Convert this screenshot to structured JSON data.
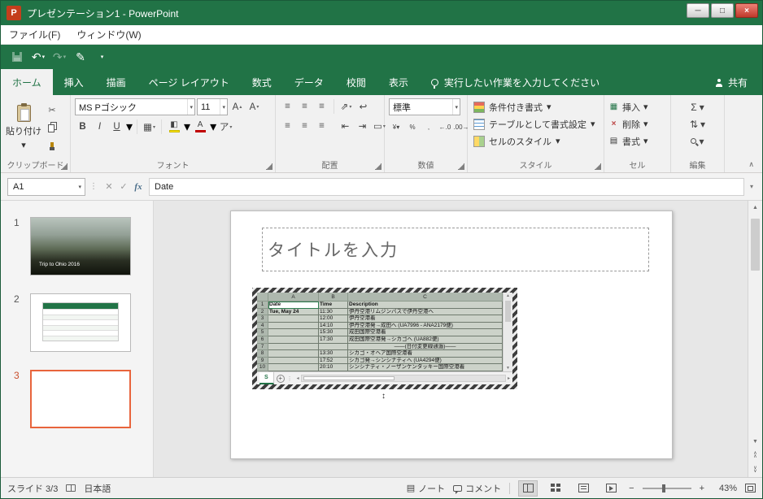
{
  "titlebar": {
    "app": "P",
    "title": "プレゼンテーション1 - PowerPoint"
  },
  "menubar": {
    "file": "ファイル(F)",
    "window": "ウィンドウ(W)"
  },
  "icons": {
    "minimize": "─",
    "maximize": "□",
    "close": "×",
    "undo": "↶",
    "redo": "↷",
    "pen": "✎",
    "caret": "▾",
    "scissors": "✂",
    "tri_up": "▴",
    "tri_down": "▾",
    "A": "A",
    "borders": "▦",
    "fill": "◧",
    "phonetic": "ア",
    "align": "≡",
    "orient": "⇗",
    "wrap": "↩",
    "indent_dec": "⇤",
    "indent_inc": "⇥",
    "merge": "▭",
    "currency": "¥",
    "percent": "%",
    "comma": ",",
    "inc_dec": "←.0",
    "dec_dec": ".00→",
    "autosum": "Σ",
    "sort": "⇅",
    "up": "▲",
    "down": "▼",
    "chev_up": "∧",
    "chev_down": "∨",
    "left": "◂",
    "right": "▸",
    "dots": "⋮",
    "updown": "↕",
    "notes": "▤",
    "collapse": "∧"
  },
  "ribbon": {
    "tabs": [
      "ホーム",
      "挿入",
      "描画",
      "ページ レイアウト",
      "数式",
      "データ",
      "校閲",
      "表示"
    ],
    "tellme": "実行したい作業を入力してください",
    "share": "共有",
    "clipboard": {
      "label": "クリップボード",
      "paste": "貼り付け"
    },
    "font": {
      "label": "フォント",
      "name": "MS Pゴシック",
      "size": "11",
      "bold": "B",
      "italic": "I",
      "underline": "U"
    },
    "align": {
      "label": "配置"
    },
    "number": {
      "label": "数値",
      "format": "標準"
    },
    "styles": {
      "label": "スタイル",
      "conditional": "条件付き書式",
      "table": "テーブルとして書式設定",
      "cell": "セルのスタイル"
    },
    "cells": {
      "label": "セル",
      "insert": "挿入",
      "delete": "削除",
      "format": "書式"
    },
    "editing": {
      "label": "編集"
    }
  },
  "formula": {
    "name": "A1",
    "cancel": "✕",
    "enter": "✓",
    "fx": "fx",
    "value": "Date"
  },
  "thumbnails": {
    "n1": "1",
    "n2": "2",
    "n3": "3",
    "caption": "Trip to Ohio 2016"
  },
  "slide": {
    "title_placeholder": "タイトルを入力"
  },
  "sheet": {
    "cols": [
      "A",
      "B",
      "C"
    ],
    "rows": [
      {
        "n": "1",
        "a": "Date",
        "b": "Time",
        "c": "Description"
      },
      {
        "n": "2",
        "a": "Tue, May 24",
        "b": "11:30",
        "c": "伊丹空港リムジンバスで伊丹空港へ"
      },
      {
        "n": "3",
        "a": "",
        "b": "12:00",
        "c": "伊丹空港着"
      },
      {
        "n": "4",
        "a": "",
        "b": "14:10",
        "c": "伊丹空港発→成田へ (UA7996 - ANA2179便)"
      },
      {
        "n": "5",
        "a": "",
        "b": "15:30",
        "c": "成田国際空港着"
      },
      {
        "n": "6",
        "a": "",
        "b": "17:30",
        "c": "成田国際空港発→シカゴへ (UA882便)"
      },
      {
        "n": "7",
        "a": "",
        "b": "",
        "c": "――(日付変更線通過)――"
      },
      {
        "n": "8",
        "a": "",
        "b": "13:30",
        "c": "シカゴ・オヘア国際空港着"
      },
      {
        "n": "9",
        "a": "",
        "b": "17:52",
        "c": "シカゴ発→シンシナティへ (UA4294便)"
      },
      {
        "n": "10",
        "a": "",
        "b": "20:10",
        "c": "シンシナティ・ノーザンケンタッキー国際空港着"
      }
    ],
    "tab": "S",
    "add": "+"
  },
  "statusbar": {
    "slides": "スライド 3/3",
    "lang": "日本語",
    "notes": "ノート",
    "comments": "コメント",
    "zoom_out": "−",
    "zoom_in": "+",
    "zoom": "43%"
  }
}
